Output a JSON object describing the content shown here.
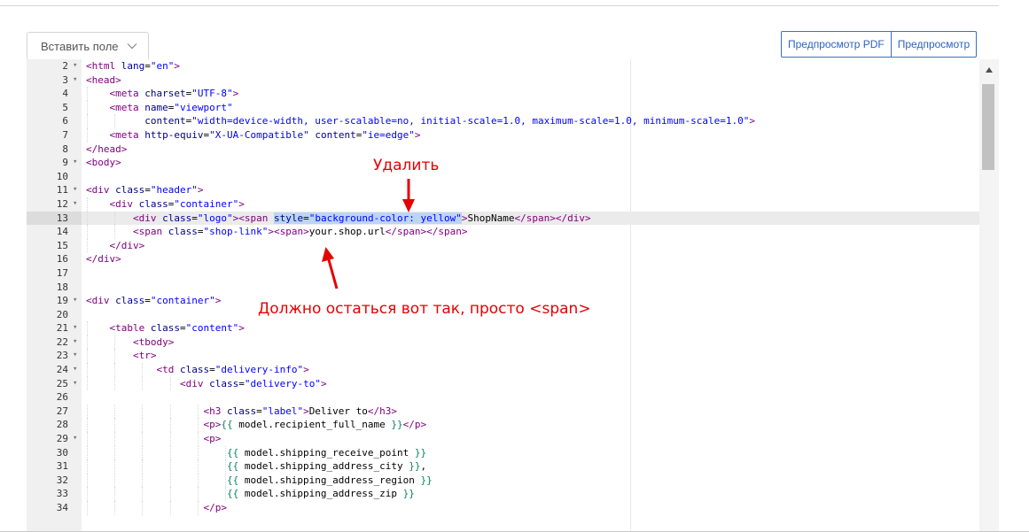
{
  "toolbar": {
    "insert_field_label": "Вставить поле",
    "preview_pdf_label": "Предпросмотр PDF",
    "preview_label": "Предпросмотр"
  },
  "annotations": {
    "delete_label": "Удалить",
    "keep_label": "Должно остаться вот так, просто <span>",
    "color": "#e60000"
  },
  "editor": {
    "active_line": "13",
    "lines": [
      {
        "num": "2",
        "fold": true,
        "guides": 0,
        "tokens": [
          [
            "t",
            "<html "
          ],
          [
            "a",
            "lang"
          ],
          [
            "x",
            "="
          ],
          [
            "s",
            "\"en\""
          ],
          [
            "t",
            ">"
          ]
        ]
      },
      {
        "num": "3",
        "fold": true,
        "guides": 0,
        "tokens": [
          [
            "t",
            "<head>"
          ]
        ]
      },
      {
        "num": "4",
        "fold": false,
        "guides": 1,
        "tokens": [
          [
            "x",
            "    "
          ],
          [
            "t",
            "<meta "
          ],
          [
            "a",
            "charset"
          ],
          [
            "x",
            "="
          ],
          [
            "s",
            "\"UTF-8\""
          ],
          [
            "t",
            ">"
          ]
        ]
      },
      {
        "num": "5",
        "fold": false,
        "guides": 1,
        "tokens": [
          [
            "x",
            "    "
          ],
          [
            "t",
            "<meta "
          ],
          [
            "a",
            "name"
          ],
          [
            "x",
            "="
          ],
          [
            "s",
            "\"viewport\""
          ]
        ]
      },
      {
        "num": "6",
        "fold": false,
        "guides": 2,
        "tokens": [
          [
            "x",
            "          "
          ],
          [
            "a",
            "content"
          ],
          [
            "x",
            "="
          ],
          [
            "s",
            "\"width=device-width, user-scalable=no, initial-scale=1.0, maximum-scale=1.0, minimum-scale=1.0\""
          ],
          [
            "t",
            ">"
          ]
        ]
      },
      {
        "num": "7",
        "fold": false,
        "guides": 1,
        "tokens": [
          [
            "x",
            "    "
          ],
          [
            "t",
            "<meta "
          ],
          [
            "a",
            "http-equiv"
          ],
          [
            "x",
            "="
          ],
          [
            "s",
            "\"X-UA-Compatible\""
          ],
          [
            "x",
            " "
          ],
          [
            "a",
            "content"
          ],
          [
            "x",
            "="
          ],
          [
            "s",
            "\"ie=edge\""
          ],
          [
            "t",
            ">"
          ]
        ]
      },
      {
        "num": "8",
        "fold": false,
        "guides": 0,
        "tokens": [
          [
            "t",
            "</head>"
          ]
        ]
      },
      {
        "num": "9",
        "fold": true,
        "guides": 0,
        "tokens": [
          [
            "t",
            "<body>"
          ]
        ]
      },
      {
        "num": "10",
        "fold": false,
        "guides": 0,
        "tokens": []
      },
      {
        "num": "11",
        "fold": true,
        "guides": 0,
        "tokens": [
          [
            "t",
            "<div "
          ],
          [
            "a",
            "class"
          ],
          [
            "x",
            "="
          ],
          [
            "s",
            "\"header\""
          ],
          [
            "t",
            ">"
          ]
        ]
      },
      {
        "num": "12",
        "fold": true,
        "guides": 1,
        "tokens": [
          [
            "x",
            "    "
          ],
          [
            "t",
            "<div "
          ],
          [
            "a",
            "class"
          ],
          [
            "x",
            "="
          ],
          [
            "s",
            "\"container\""
          ],
          [
            "t",
            ">"
          ]
        ]
      },
      {
        "num": "13",
        "fold": false,
        "guides": 2,
        "tokens": [
          [
            "x",
            "        "
          ],
          [
            "t",
            "<div "
          ],
          [
            "a",
            "class"
          ],
          [
            "x",
            "="
          ],
          [
            "s",
            "\"logo\""
          ],
          [
            "t",
            "><span "
          ],
          [
            "A",
            "style"
          ],
          [
            "X",
            "="
          ],
          [
            "S",
            "\"background-color: yellow\""
          ],
          [
            "t",
            ">"
          ],
          [
            "x",
            "ShopName"
          ],
          [
            "t",
            "</span></div>"
          ]
        ]
      },
      {
        "num": "14",
        "fold": false,
        "guides": 2,
        "tokens": [
          [
            "x",
            "        "
          ],
          [
            "t",
            "<span "
          ],
          [
            "a",
            "class"
          ],
          [
            "x",
            "="
          ],
          [
            "s",
            "\"shop-link\""
          ],
          [
            "t",
            "><span>"
          ],
          [
            "x",
            "your.shop.url"
          ],
          [
            "t",
            "</span></span>"
          ]
        ]
      },
      {
        "num": "15",
        "fold": false,
        "guides": 1,
        "tokens": [
          [
            "x",
            "    "
          ],
          [
            "t",
            "</div>"
          ]
        ]
      },
      {
        "num": "16",
        "fold": false,
        "guides": 0,
        "tokens": [
          [
            "t",
            "</div>"
          ]
        ]
      },
      {
        "num": "17",
        "fold": false,
        "guides": 0,
        "tokens": []
      },
      {
        "num": "18",
        "fold": false,
        "guides": 0,
        "tokens": []
      },
      {
        "num": "19",
        "fold": true,
        "guides": 0,
        "tokens": [
          [
            "t",
            "<div "
          ],
          [
            "a",
            "class"
          ],
          [
            "x",
            "="
          ],
          [
            "s",
            "\"container\""
          ],
          [
            "t",
            ">"
          ]
        ]
      },
      {
        "num": "20",
        "fold": false,
        "guides": 0,
        "tokens": []
      },
      {
        "num": "21",
        "fold": true,
        "guides": 1,
        "tokens": [
          [
            "x",
            "    "
          ],
          [
            "t",
            "<table "
          ],
          [
            "a",
            "class"
          ],
          [
            "x",
            "="
          ],
          [
            "s",
            "\"content\""
          ],
          [
            "t",
            ">"
          ]
        ]
      },
      {
        "num": "22",
        "fold": true,
        "guides": 2,
        "tokens": [
          [
            "x",
            "        "
          ],
          [
            "t",
            "<tbody>"
          ]
        ]
      },
      {
        "num": "23",
        "fold": true,
        "guides": 2,
        "tokens": [
          [
            "x",
            "        "
          ],
          [
            "t",
            "<tr>"
          ]
        ]
      },
      {
        "num": "24",
        "fold": true,
        "guides": 3,
        "tokens": [
          [
            "x",
            "            "
          ],
          [
            "t",
            "<td "
          ],
          [
            "a",
            "class"
          ],
          [
            "x",
            "="
          ],
          [
            "s",
            "\"delivery-info\""
          ],
          [
            "t",
            ">"
          ]
        ]
      },
      {
        "num": "25",
        "fold": true,
        "guides": 4,
        "tokens": [
          [
            "x",
            "                "
          ],
          [
            "t",
            "<div "
          ],
          [
            "a",
            "class"
          ],
          [
            "x",
            "="
          ],
          [
            "s",
            "\"delivery-to\""
          ],
          [
            "t",
            ">"
          ]
        ]
      },
      {
        "num": "26",
        "fold": false,
        "guides": 0,
        "tokens": []
      },
      {
        "num": "27",
        "fold": false,
        "guides": 5,
        "tokens": [
          [
            "x",
            "                    "
          ],
          [
            "t",
            "<h3 "
          ],
          [
            "a",
            "class"
          ],
          [
            "x",
            "="
          ],
          [
            "s",
            "\"label\""
          ],
          [
            "t",
            ">"
          ],
          [
            "x",
            "Deliver to"
          ],
          [
            "t",
            "</h3>"
          ]
        ]
      },
      {
        "num": "28",
        "fold": false,
        "guides": 5,
        "tokens": [
          [
            "x",
            "                    "
          ],
          [
            "t",
            "<p>"
          ],
          [
            "p",
            "{{"
          ],
          [
            "x",
            " model.recipient_full_name "
          ],
          [
            "p",
            "}}"
          ],
          [
            "t",
            "</p>"
          ]
        ]
      },
      {
        "num": "29",
        "fold": true,
        "guides": 5,
        "tokens": [
          [
            "x",
            "                    "
          ],
          [
            "t",
            "<p>"
          ]
        ]
      },
      {
        "num": "30",
        "fold": false,
        "guides": 6,
        "tokens": [
          [
            "x",
            "                        "
          ],
          [
            "p",
            "{{"
          ],
          [
            "x",
            " model.shipping_receive_point "
          ],
          [
            "p",
            "}}"
          ]
        ]
      },
      {
        "num": "31",
        "fold": false,
        "guides": 6,
        "tokens": [
          [
            "x",
            "                        "
          ],
          [
            "p",
            "{{"
          ],
          [
            "x",
            " model.shipping_address_city "
          ],
          [
            "p",
            "}}"
          ],
          [
            "x",
            ","
          ]
        ]
      },
      {
        "num": "32",
        "fold": false,
        "guides": 6,
        "tokens": [
          [
            "x",
            "                        "
          ],
          [
            "p",
            "{{"
          ],
          [
            "x",
            " model.shipping_address_region "
          ],
          [
            "p",
            "}}"
          ]
        ]
      },
      {
        "num": "33",
        "fold": false,
        "guides": 6,
        "tokens": [
          [
            "x",
            "                        "
          ],
          [
            "p",
            "{{"
          ],
          [
            "x",
            " model.shipping_address_zip "
          ],
          [
            "p",
            "}}"
          ]
        ]
      },
      {
        "num": "34",
        "fold": false,
        "guides": 5,
        "tokens": [
          [
            "x",
            "                    "
          ],
          [
            "t",
            "</p>"
          ]
        ]
      }
    ]
  }
}
